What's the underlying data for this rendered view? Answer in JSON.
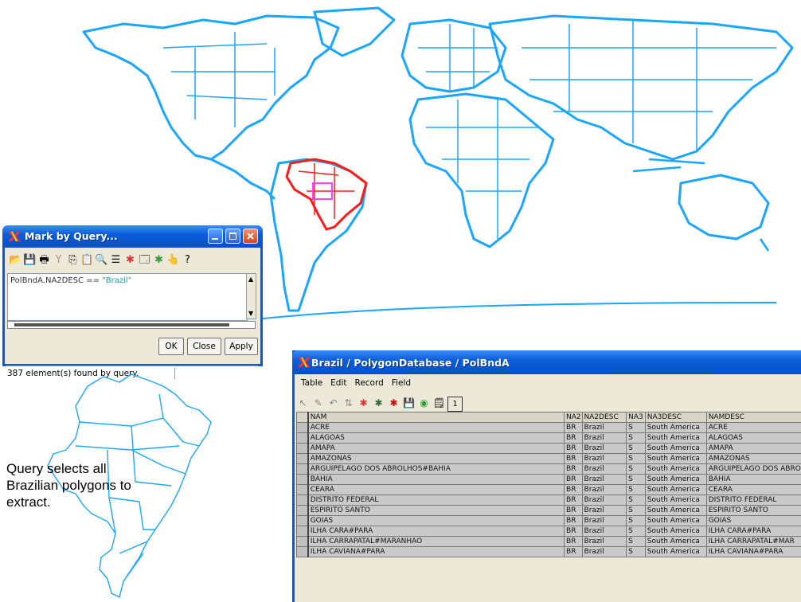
{
  "mark_dialog": {
    "title": "Mark by Query...",
    "query_field": "PolBndA.NA2DESC",
    "query_operator": "==",
    "query_value": "\"Brazil\"",
    "buttons": {
      "ok": "OK",
      "close": "Close",
      "apply": "Apply"
    },
    "status": "387 element(s) found by query."
  },
  "table_window": {
    "title": "Brazil / PolygonDatabase / PolBndA",
    "menu": [
      "Table",
      "Edit",
      "Record",
      "Field"
    ],
    "columns": [
      "NAM",
      "NA2",
      "NA2DESC",
      "NA3",
      "NA3DESC",
      "NAMDESC"
    ],
    "rows": [
      [
        "ACRE",
        "BR",
        "Brazil",
        "S",
        "South America",
        "ACRE"
      ],
      [
        "ALAGOAS",
        "BR",
        "Brazil",
        "S",
        "South America",
        "ALAGOAS"
      ],
      [
        "AMAPA",
        "BR",
        "Brazil",
        "S",
        "South America",
        "AMAPA"
      ],
      [
        "AMAZONAS",
        "BR",
        "Brazil",
        "S",
        "South America",
        "AMAZONAS"
      ],
      [
        "ARGUIPELAGO DOS ABROLHOS#BAHIA",
        "BR",
        "Brazil",
        "S",
        "South America",
        "ARGUIPELAGO DOS ABRO"
      ],
      [
        "BAHIA",
        "BR",
        "Brazil",
        "S",
        "South America",
        "BAHIA"
      ],
      [
        "CEARA",
        "BR",
        "Brazil",
        "S",
        "South America",
        "CEARA"
      ],
      [
        "DISTRITO FEDERAL",
        "BR",
        "Brazil",
        "S",
        "South America",
        "DISTRITO FEDERAL"
      ],
      [
        "ESPIRITO SANTO",
        "BR",
        "Brazil",
        "S",
        "South America",
        "ESPIRITO SANTO"
      ],
      [
        "GOIAS",
        "BR",
        "Brazil",
        "S",
        "South America",
        "GOIAS"
      ],
      [
        "ILHA CARA#PARA",
        "BR",
        "Brazil",
        "S",
        "South America",
        "ILHA CARA#PARA"
      ],
      [
        "ILHA CARRAPATAL#MARANHAO",
        "BR",
        "Brazil",
        "S",
        "South America",
        "ILHA CARRAPATAL#MAR"
      ],
      [
        "ILHA CAVIANA#PARA",
        "BR",
        "Brazil",
        "S",
        "South America",
        "ILHA CAVIANA#PARA"
      ]
    ]
  },
  "caption": "Query selects all Brazilian polygons to extract.",
  "colors": {
    "map_lines": "#19a6ff",
    "selected": "#ff1a1a",
    "highlight": "#ff40ff",
    "titlebar": "#0a59d8"
  },
  "icons": [
    "open-icon",
    "save-icon",
    "print-icon",
    "filter-icon",
    "copy-icon",
    "paste-icon",
    "find-icon",
    "list-icon",
    "mark-icon",
    "window-icon",
    "unmark-icon",
    "info-icon",
    "help-icon"
  ]
}
